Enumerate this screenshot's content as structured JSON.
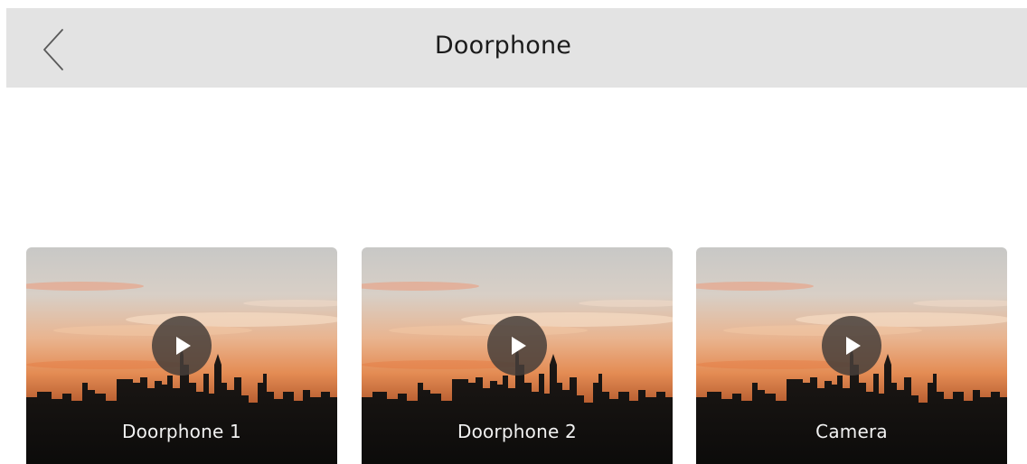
{
  "header": {
    "title": "Doorphone",
    "back_icon": "chevron-left-icon",
    "background": "#e3e3e3"
  },
  "cards": [
    {
      "label": "Doorphone 1",
      "icon": "play-icon"
    },
    {
      "label": "Doorphone 2",
      "icon": "play-icon"
    },
    {
      "label": "Camera",
      "icon": "play-icon"
    }
  ]
}
